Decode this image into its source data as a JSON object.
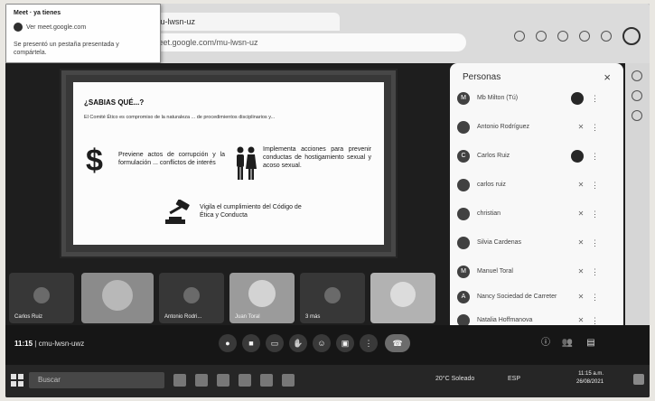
{
  "browser": {
    "tab_title": "mu-lwsn-uz",
    "address": "meet.google.com/mu-lwsn-uz"
  },
  "notification": {
    "line1": "Meet · ya tienes",
    "line2": "Ver meet.google.com",
    "line3": "Se presentó un pestaña presentada y compártela."
  },
  "slide": {
    "title": "¿SABIAS QUÉ...?",
    "subtitle": "El Comité Ético es compromiso de la naturaleza ... de procedimientos disciplinarios y...",
    "dollar": "$",
    "item1": "Previene actos de corrupción y la formulación ... conflictos de interés",
    "item2": "Implementa acciones para prevenir conductas de hostigamiento sexual y acoso sexual.",
    "item3": "Vigila el cumplimiento del Código de Ética y Conducta"
  },
  "people_panel": {
    "title": "Personas",
    "close": "×",
    "people": [
      {
        "initial": "M",
        "name": "Mb Milton (Tú)"
      },
      {
        "initial": "",
        "name": "Antonio Rodríguez"
      },
      {
        "initial": "C",
        "name": "Carlos Ruiz"
      },
      {
        "initial": "",
        "name": "carlos ruiz"
      },
      {
        "initial": "",
        "name": "christian"
      },
      {
        "initial": "",
        "name": "Silvia Cardenas"
      },
      {
        "initial": "M",
        "name": "Manuel Toral"
      },
      {
        "initial": "A",
        "name": "Nancy Sociedad de Carreter"
      },
      {
        "initial": "",
        "name": "Natalia Hoffmanova"
      }
    ]
  },
  "tiles": [
    {
      "label": "Carlos Ruiz"
    },
    {
      "label": ""
    },
    {
      "label": "Antonio Rodri..."
    },
    {
      "label": "Juan Toral"
    },
    {
      "label": "3 más"
    },
    {
      "label": ""
    }
  ],
  "controls": {
    "time": "11:15",
    "separator": "|",
    "meeting_code": "cmu-lwsn-uwz"
  },
  "taskbar": {
    "search_placeholder": "Buscar",
    "weather": "20°C Soleado",
    "tray": "ESP",
    "clock_time": "11:15 a.m.",
    "clock_date": "26/08/2021"
  }
}
